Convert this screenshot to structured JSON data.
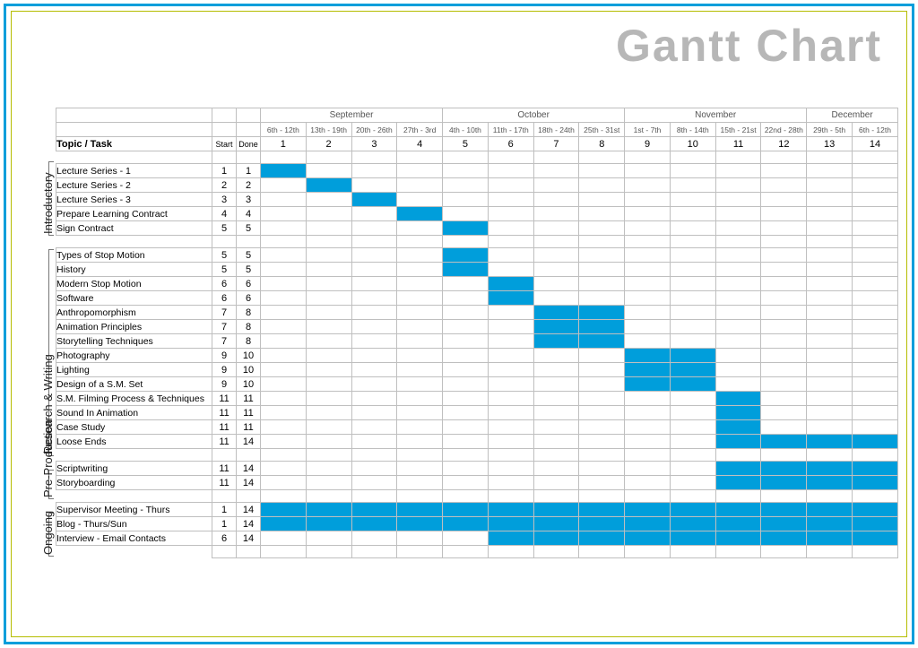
{
  "title": "Gantt Chart",
  "columns": {
    "topic_header": "Topic / Task",
    "start_header": "Start",
    "done_header": "Done"
  },
  "months": [
    {
      "name": "September",
      "span": 4
    },
    {
      "name": "October",
      "span": 4
    },
    {
      "name": "November",
      "span": 4
    },
    {
      "name": "December",
      "span": 2
    }
  ],
  "week_ranges": [
    "6th - 12th",
    "13th - 19th",
    "20th - 26th",
    "27th - 3rd",
    "4th - 10th",
    "11th - 17th",
    "18th - 24th",
    "25th - 31st",
    "1st - 7th",
    "8th - 14th",
    "15th - 21st",
    "22nd - 28th",
    "29th - 5th",
    "6th - 12th"
  ],
  "week_numbers": [
    1,
    2,
    3,
    4,
    5,
    6,
    7,
    8,
    9,
    10,
    11,
    12,
    13,
    14
  ],
  "sections": [
    {
      "name": "Introductory",
      "leading_blank": true,
      "tasks": [
        {
          "name": "Lecture Series - 1",
          "start": 1,
          "done": 1
        },
        {
          "name": "Lecture Series - 2",
          "start": 2,
          "done": 2
        },
        {
          "name": "Lecture Series - 3",
          "start": 3,
          "done": 3
        },
        {
          "name": "Prepare Learning Contract",
          "start": 4,
          "done": 4
        },
        {
          "name": "Sign Contract",
          "start": 5,
          "done": 5
        }
      ]
    },
    {
      "name": "Research & Writing",
      "leading_blank": true,
      "tasks": [
        {
          "name": "Types of Stop Motion",
          "start": 5,
          "done": 5
        },
        {
          "name": "History",
          "start": 5,
          "done": 5
        },
        {
          "name": "Modern Stop Motion",
          "start": 6,
          "done": 6
        },
        {
          "name": "Software",
          "start": 6,
          "done": 6
        },
        {
          "name": "Anthropomorphism",
          "start": 7,
          "done": 8
        },
        {
          "name": "Animation Principles",
          "start": 7,
          "done": 8
        },
        {
          "name": "Storytelling Techniques",
          "start": 7,
          "done": 8
        },
        {
          "name": "Photography",
          "start": 9,
          "done": 10
        },
        {
          "name": "Lighting",
          "start": 9,
          "done": 10
        },
        {
          "name": "Design of a S.M. Set",
          "start": 9,
          "done": 10
        },
        {
          "name": "S.M. Filming Process & Techniques",
          "start": 11,
          "done": 11
        },
        {
          "name": "Sound In Animation",
          "start": 11,
          "done": 11
        },
        {
          "name": "Case Study",
          "start": 11,
          "done": 11
        },
        {
          "name": "Loose Ends",
          "start": 11,
          "done": 14
        }
      ]
    },
    {
      "name": "Pre-Production",
      "leading_blank": true,
      "tasks": [
        {
          "name": "Scriptwriting",
          "start": 11,
          "done": 14
        },
        {
          "name": "Storyboarding",
          "start": 11,
          "done": 14
        }
      ]
    },
    {
      "name": "Ongoing",
      "leading_blank": true,
      "tasks": [
        {
          "name": "Supervisor Meeting - Thurs",
          "start": 1,
          "done": 14
        },
        {
          "name": "Blog - Thurs/Sun",
          "start": 1,
          "done": 14
        },
        {
          "name": "Interview - Email Contacts",
          "start": 6,
          "done": 14
        }
      ]
    }
  ],
  "chart_data": {
    "type": "gantt",
    "title": "Gantt Chart",
    "x_unit": "week",
    "x_categories": [
      1,
      2,
      3,
      4,
      5,
      6,
      7,
      8,
      9,
      10,
      11,
      12,
      13,
      14
    ],
    "x_date_ranges": [
      "Sep 6-12",
      "Sep 13-19",
      "Sep 20-26",
      "Sep 27-Oct 3",
      "Oct 4-10",
      "Oct 11-17",
      "Oct 18-24",
      "Oct 25-31",
      "Nov 1-7",
      "Nov 8-14",
      "Nov 15-21",
      "Nov 22-28",
      "Nov 29-Dec 5",
      "Dec 6-12"
    ],
    "tasks": [
      {
        "section": "Introductory",
        "name": "Lecture Series - 1",
        "start": 1,
        "end": 1
      },
      {
        "section": "Introductory",
        "name": "Lecture Series - 2",
        "start": 2,
        "end": 2
      },
      {
        "section": "Introductory",
        "name": "Lecture Series - 3",
        "start": 3,
        "end": 3
      },
      {
        "section": "Introductory",
        "name": "Prepare Learning Contract",
        "start": 4,
        "end": 4
      },
      {
        "section": "Introductory",
        "name": "Sign Contract",
        "start": 5,
        "end": 5
      },
      {
        "section": "Research & Writing",
        "name": "Types of Stop Motion",
        "start": 5,
        "end": 5
      },
      {
        "section": "Research & Writing",
        "name": "History",
        "start": 5,
        "end": 5
      },
      {
        "section": "Research & Writing",
        "name": "Modern Stop Motion",
        "start": 6,
        "end": 6
      },
      {
        "section": "Research & Writing",
        "name": "Software",
        "start": 6,
        "end": 6
      },
      {
        "section": "Research & Writing",
        "name": "Anthropomorphism",
        "start": 7,
        "end": 8
      },
      {
        "section": "Research & Writing",
        "name": "Animation Principles",
        "start": 7,
        "end": 8
      },
      {
        "section": "Research & Writing",
        "name": "Storytelling Techniques",
        "start": 7,
        "end": 8
      },
      {
        "section": "Research & Writing",
        "name": "Photography",
        "start": 9,
        "end": 10
      },
      {
        "section": "Research & Writing",
        "name": "Lighting",
        "start": 9,
        "end": 10
      },
      {
        "section": "Research & Writing",
        "name": "Design of a S.M. Set",
        "start": 9,
        "end": 10
      },
      {
        "section": "Research & Writing",
        "name": "S.M. Filming Process & Techniques",
        "start": 11,
        "end": 11
      },
      {
        "section": "Research & Writing",
        "name": "Sound In Animation",
        "start": 11,
        "end": 11
      },
      {
        "section": "Research & Writing",
        "name": "Case Study",
        "start": 11,
        "end": 11
      },
      {
        "section": "Research & Writing",
        "name": "Loose Ends",
        "start": 11,
        "end": 14
      },
      {
        "section": "Pre-Production",
        "name": "Scriptwriting",
        "start": 11,
        "end": 14
      },
      {
        "section": "Pre-Production",
        "name": "Storyboarding",
        "start": 11,
        "end": 14
      },
      {
        "section": "Ongoing",
        "name": "Supervisor Meeting - Thurs",
        "start": 1,
        "end": 14
      },
      {
        "section": "Ongoing",
        "name": "Blog - Thurs/Sun",
        "start": 1,
        "end": 14
      },
      {
        "section": "Ongoing",
        "name": "Interview - Email Contacts",
        "start": 6,
        "end": 14
      }
    ]
  }
}
